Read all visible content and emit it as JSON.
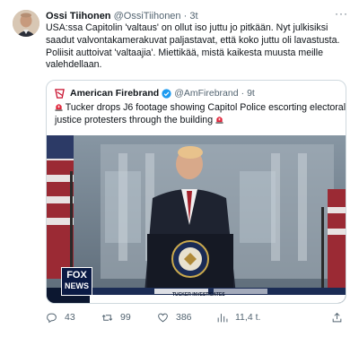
{
  "tweet": {
    "author_name": "Ossi Tiihonen",
    "author_handle": "@OssiTiihonen",
    "separator": "·",
    "time": "3t",
    "more_label": "···",
    "text_lines": [
      "USA:ssa Capitolin 'valtaus' on ollut iso juttu jo pitkään. Nyt julkisiksi",
      "saadut valvontakamerakuvat paljastavat, että koko juttu oli lavastusta.",
      "Poliisit auttoivat 'valtaajia'. Miettikää, mistä kaikesta muusta meille",
      "valehdellaan."
    ]
  },
  "quote": {
    "name": "American Firebrand",
    "handle": "@AmFirebrand",
    "separator": "·",
    "time": "9t",
    "text_line1": "Tucker drops J6 footage showing Capitol Police escorting electoral",
    "text_line2": "justice protesters through the building"
  },
  "media": {
    "network_logo_top": "FOX",
    "network_logo_bottom": "NEWS",
    "ticker": "TUCKER INVESTIGATES"
  },
  "actions": {
    "replies": "43",
    "retweets": "99",
    "likes": "386",
    "views": "11,4 t."
  },
  "colors": {
    "text": "#0f1419",
    "secondary": "#536471",
    "border": "#cfd9de",
    "verified": "#1d9bf0",
    "firebrand_red": "#c8102e"
  }
}
